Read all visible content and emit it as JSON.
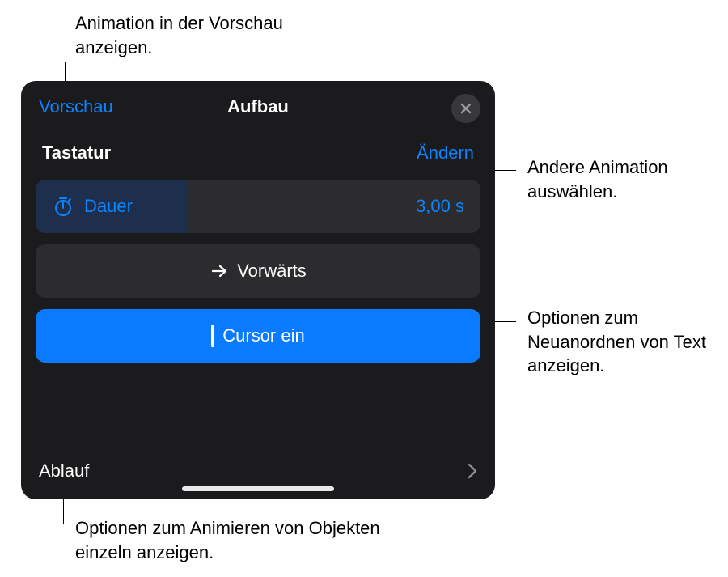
{
  "annotations": {
    "preview": "Animation in der Vorschau anzeigen.",
    "change": "Andere Animation auswählen.",
    "direction": "Optionen zum Neuanordnen von Text anzeigen.",
    "ablauf": "Optionen zum Animieren von Objekten einzeln anzeigen."
  },
  "panel": {
    "preview_label": "Vorschau",
    "title": "Aufbau",
    "effect_name": "Tastatur",
    "change_label": "Ändern",
    "duration": {
      "label": "Dauer",
      "value": "3,00 s"
    },
    "direction": {
      "label": "Vorwärts"
    },
    "cursor": {
      "label": "Cursor ein"
    },
    "ablauf_label": "Ablauf"
  },
  "colors": {
    "accent": "#0a84ff",
    "panel_bg": "#1b1b1d",
    "row_bg": "#2c2c2e",
    "active_bg": "#0a7bff"
  }
}
